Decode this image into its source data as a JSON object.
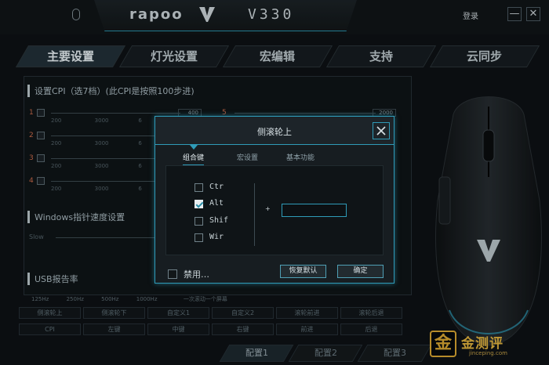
{
  "app": {
    "brand": "rapoo",
    "model": "V330",
    "login": "登录",
    "minimize": "—",
    "close": "✕"
  },
  "tabs": [
    "主要设置",
    "灯光设置",
    "宏编辑",
    "支持",
    "云同步"
  ],
  "dpi": {
    "title": "设置CPI（选7档）(此CPI是按照100步进)",
    "rows": [
      {
        "num": "1",
        "value": "400"
      },
      {
        "num": "2",
        "value": ""
      },
      {
        "num": "3",
        "value": ""
      },
      {
        "num": "4",
        "value": ""
      },
      {
        "num": "5",
        "value": "2000"
      }
    ],
    "ticks": [
      "200",
      "3000",
      "6"
    ]
  },
  "windows_speed": {
    "title": "Windows指针速度设置",
    "slow": "Slow"
  },
  "usb": {
    "title": "USB报告率",
    "options": [
      "125Hz",
      "250Hz",
      "500Hz",
      "1000Hz",
      "一次滚动一个屏幕"
    ],
    "selected": "1000Hz"
  },
  "buttons_row1": [
    "侧滚轮上",
    "侧滚轮下",
    "自定义1",
    "自定义2",
    "滚轮前进",
    "滚轮后退"
  ],
  "buttons_row2": [
    "CPI",
    "左键",
    "中键",
    "右键",
    "前进",
    "后退"
  ],
  "configs": [
    "配置1",
    "配置2",
    "配置3"
  ],
  "watermark": {
    "icon": "金",
    "name": "金测评",
    "url": "jinceping.com"
  },
  "dialog": {
    "title": "侧滚轮上",
    "tabs": [
      "组合键",
      "宏设置",
      "基本功能"
    ],
    "active_tab": "组合键",
    "modifiers": [
      {
        "label": "Ctr",
        "checked": false
      },
      {
        "label": "Alt",
        "checked": true
      },
      {
        "label": "Shif",
        "checked": false
      },
      {
        "label": "Wir",
        "checked": false
      }
    ],
    "plus": "+",
    "key_value": "",
    "disable_label": "禁用…",
    "disable_checked": false,
    "restore_button": "恢复默认",
    "ok_button": "确定"
  }
}
